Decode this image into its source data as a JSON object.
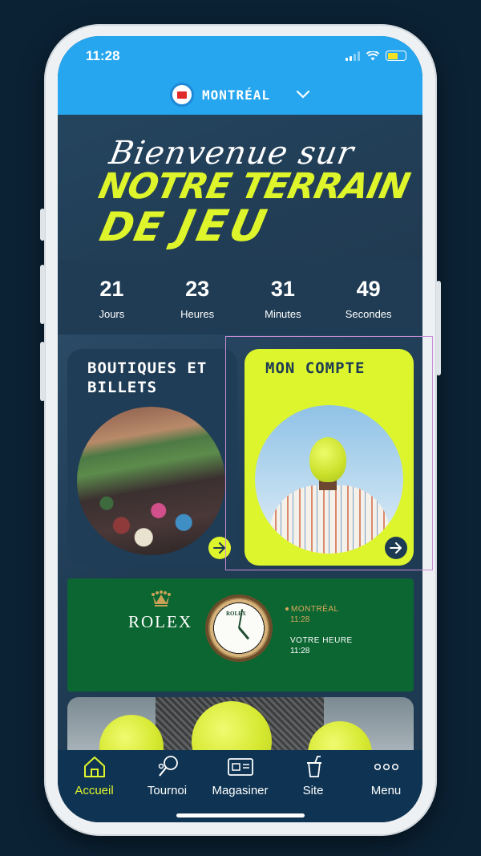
{
  "status_bar": {
    "time": "11:28"
  },
  "location": {
    "name": "MONTRÉAL"
  },
  "hero": {
    "line1": "Bienvenue sur",
    "line2": "NOTRE TERRAIN",
    "line3a": "DE",
    "line3b": "JEU"
  },
  "countdown": [
    {
      "value": "21",
      "label": "Jours"
    },
    {
      "value": "23",
      "label": "Heures"
    },
    {
      "value": "31",
      "label": "Minutes"
    },
    {
      "value": "49",
      "label": "Secondes"
    }
  ],
  "cards": {
    "shop": {
      "line1": "BOUTIQUES ET",
      "line2": "BILLETS"
    },
    "account": {
      "title": "MON COMPTE"
    }
  },
  "rolex": {
    "brand": "ROLEX",
    "dial_brand": "ROLEX",
    "city_label": "MONTRÉAL",
    "city_time": "11:28",
    "your_label": "VOTRE HEURE",
    "your_time": "11:28"
  },
  "tabs": [
    {
      "label": "Accueil",
      "icon": "home-icon",
      "active": true
    },
    {
      "label": "Tournoi",
      "icon": "racket-icon",
      "active": false
    },
    {
      "label": "Magasiner",
      "icon": "shop-icon",
      "active": false
    },
    {
      "label": "Site",
      "icon": "drink-icon",
      "active": false
    },
    {
      "label": "Menu",
      "icon": "more-icon",
      "active": false
    }
  ],
  "colors": {
    "accent": "#dff52b",
    "topbar": "#26a6ef",
    "navy": "#203d55",
    "rolex_green": "#0c6632"
  }
}
